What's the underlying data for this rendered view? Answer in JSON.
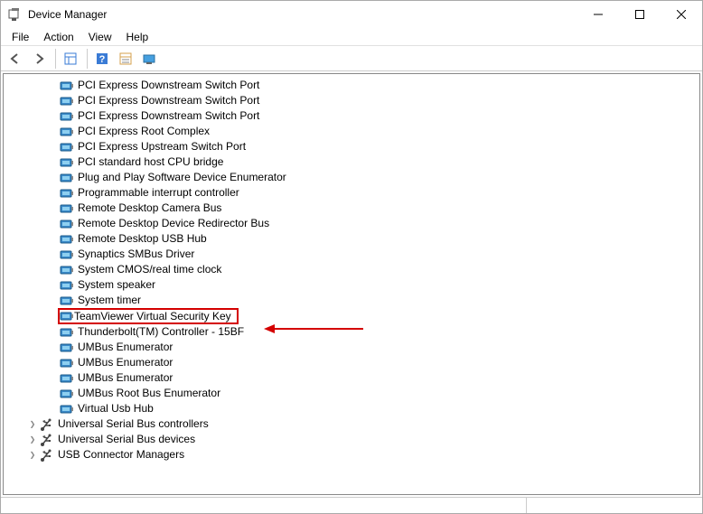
{
  "window": {
    "title": "Device Manager"
  },
  "menu": {
    "file": "File",
    "action": "Action",
    "view": "View",
    "help": "Help"
  },
  "devices": [
    {
      "label": "PCI Express Downstream Switch Port",
      "kind": "dev"
    },
    {
      "label": "PCI Express Downstream Switch Port",
      "kind": "dev"
    },
    {
      "label": "PCI Express Downstream Switch Port",
      "kind": "dev"
    },
    {
      "label": "PCI Express Root Complex",
      "kind": "dev"
    },
    {
      "label": "PCI Express Upstream Switch Port",
      "kind": "dev"
    },
    {
      "label": "PCI standard host CPU bridge",
      "kind": "dev"
    },
    {
      "label": "Plug and Play Software Device Enumerator",
      "kind": "dev"
    },
    {
      "label": "Programmable interrupt controller",
      "kind": "dev"
    },
    {
      "label": "Remote Desktop Camera Bus",
      "kind": "dev"
    },
    {
      "label": "Remote Desktop Device Redirector Bus",
      "kind": "dev"
    },
    {
      "label": "Remote Desktop USB Hub",
      "kind": "dev"
    },
    {
      "label": "Synaptics SMBus Driver",
      "kind": "dev"
    },
    {
      "label": "System CMOS/real time clock",
      "kind": "dev"
    },
    {
      "label": "System speaker",
      "kind": "dev"
    },
    {
      "label": "System timer",
      "kind": "dev"
    },
    {
      "label": "TeamViewer Virtual Security Key",
      "kind": "dev",
      "highlight": true
    },
    {
      "label": "Thunderbolt(TM) Controller - 15BF",
      "kind": "dev"
    },
    {
      "label": "UMBus Enumerator",
      "kind": "dev"
    },
    {
      "label": "UMBus Enumerator",
      "kind": "dev"
    },
    {
      "label": "UMBus Enumerator",
      "kind": "dev"
    },
    {
      "label": "UMBus Root Bus Enumerator",
      "kind": "dev"
    },
    {
      "label": "Virtual Usb Hub",
      "kind": "dev"
    }
  ],
  "categories": [
    {
      "label": "Universal Serial Bus controllers",
      "icon": "usb"
    },
    {
      "label": "Universal Serial Bus devices",
      "icon": "usb"
    },
    {
      "label": "USB Connector Managers",
      "icon": "usb"
    }
  ]
}
